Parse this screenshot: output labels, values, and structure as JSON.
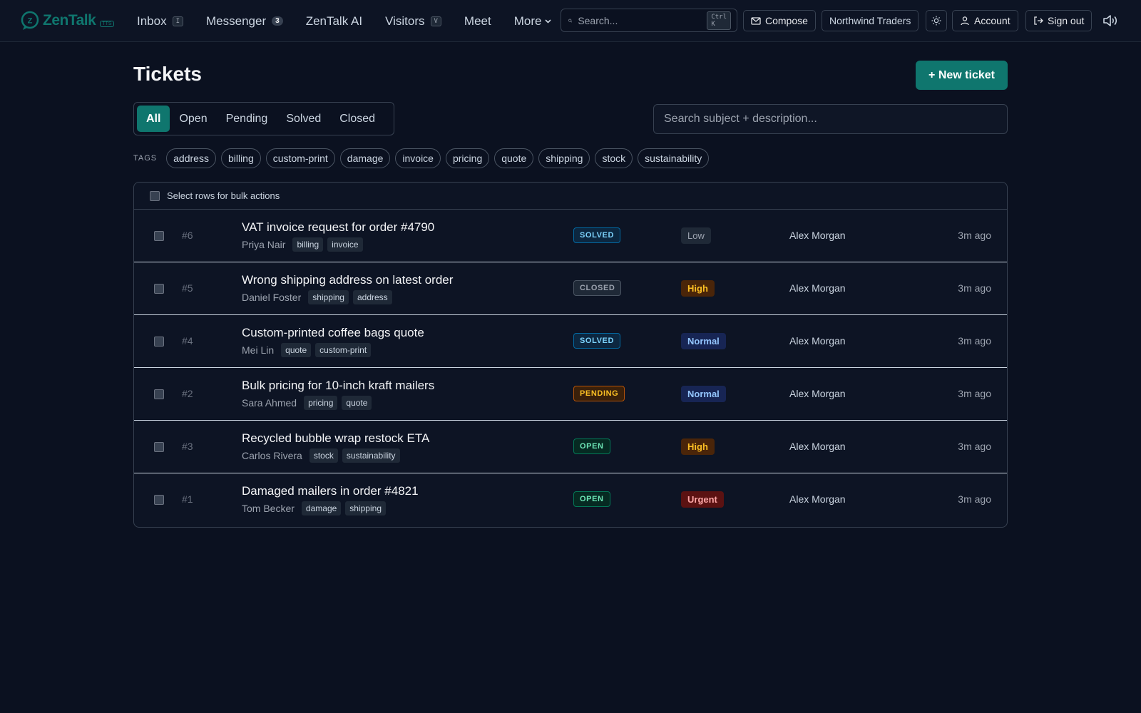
{
  "brand": {
    "name": "ZenTalk",
    "tag": "TTS",
    "color": "#0f766e"
  },
  "nav": {
    "items": [
      {
        "label": "Inbox",
        "kbd": "I"
      },
      {
        "label": "Messenger",
        "badge": "3"
      },
      {
        "label": "ZenTalk AI"
      },
      {
        "label": "Visitors",
        "kbd": "V"
      },
      {
        "label": "Meet"
      },
      {
        "label": "More"
      }
    ],
    "search_placeholder": "Search...",
    "search_shortcut": "Ctrl K",
    "compose_label": "Compose",
    "workspace_label": "Northwind Traders",
    "account_label": "Account",
    "signout_label": "Sign out"
  },
  "page": {
    "title": "Tickets",
    "new_ticket_label": "+ New ticket",
    "search_placeholder": "Search subject + description...",
    "tabs": [
      "All",
      "Open",
      "Pending",
      "Solved",
      "Closed"
    ],
    "active_tab": "All",
    "tags_label": "TAGS",
    "tags": [
      "address",
      "billing",
      "custom-print",
      "damage",
      "invoice",
      "pricing",
      "quote",
      "shipping",
      "stock",
      "sustainability"
    ],
    "bulk_label": "Select rows for bulk actions"
  },
  "tickets": [
    {
      "id": "#6",
      "subject": "VAT invoice request for order #4790",
      "requester": "Priya Nair",
      "tags": [
        "billing",
        "invoice"
      ],
      "status": "SOLVED",
      "priority": "Low",
      "assignee": "Alex Morgan",
      "time": "3m ago"
    },
    {
      "id": "#5",
      "subject": "Wrong shipping address on latest order",
      "requester": "Daniel Foster",
      "tags": [
        "shipping",
        "address"
      ],
      "status": "CLOSED",
      "priority": "High",
      "assignee": "Alex Morgan",
      "time": "3m ago"
    },
    {
      "id": "#4",
      "subject": "Custom-printed coffee bags quote",
      "requester": "Mei Lin",
      "tags": [
        "quote",
        "custom-print"
      ],
      "status": "SOLVED",
      "priority": "Normal",
      "assignee": "Alex Morgan",
      "time": "3m ago"
    },
    {
      "id": "#2",
      "subject": "Bulk pricing for 10-inch kraft mailers",
      "requester": "Sara Ahmed",
      "tags": [
        "pricing",
        "quote"
      ],
      "status": "PENDING",
      "priority": "Normal",
      "assignee": "Alex Morgan",
      "time": "3m ago"
    },
    {
      "id": "#3",
      "subject": "Recycled bubble wrap restock ETA",
      "requester": "Carlos Rivera",
      "tags": [
        "stock",
        "sustainability"
      ],
      "status": "OPEN",
      "priority": "High",
      "assignee": "Alex Morgan",
      "time": "3m ago"
    },
    {
      "id": "#1",
      "subject": "Damaged mailers in order #4821",
      "requester": "Tom Becker",
      "tags": [
        "damage",
        "shipping"
      ],
      "status": "OPEN",
      "priority": "Urgent",
      "assignee": "Alex Morgan",
      "time": "3m ago"
    }
  ]
}
